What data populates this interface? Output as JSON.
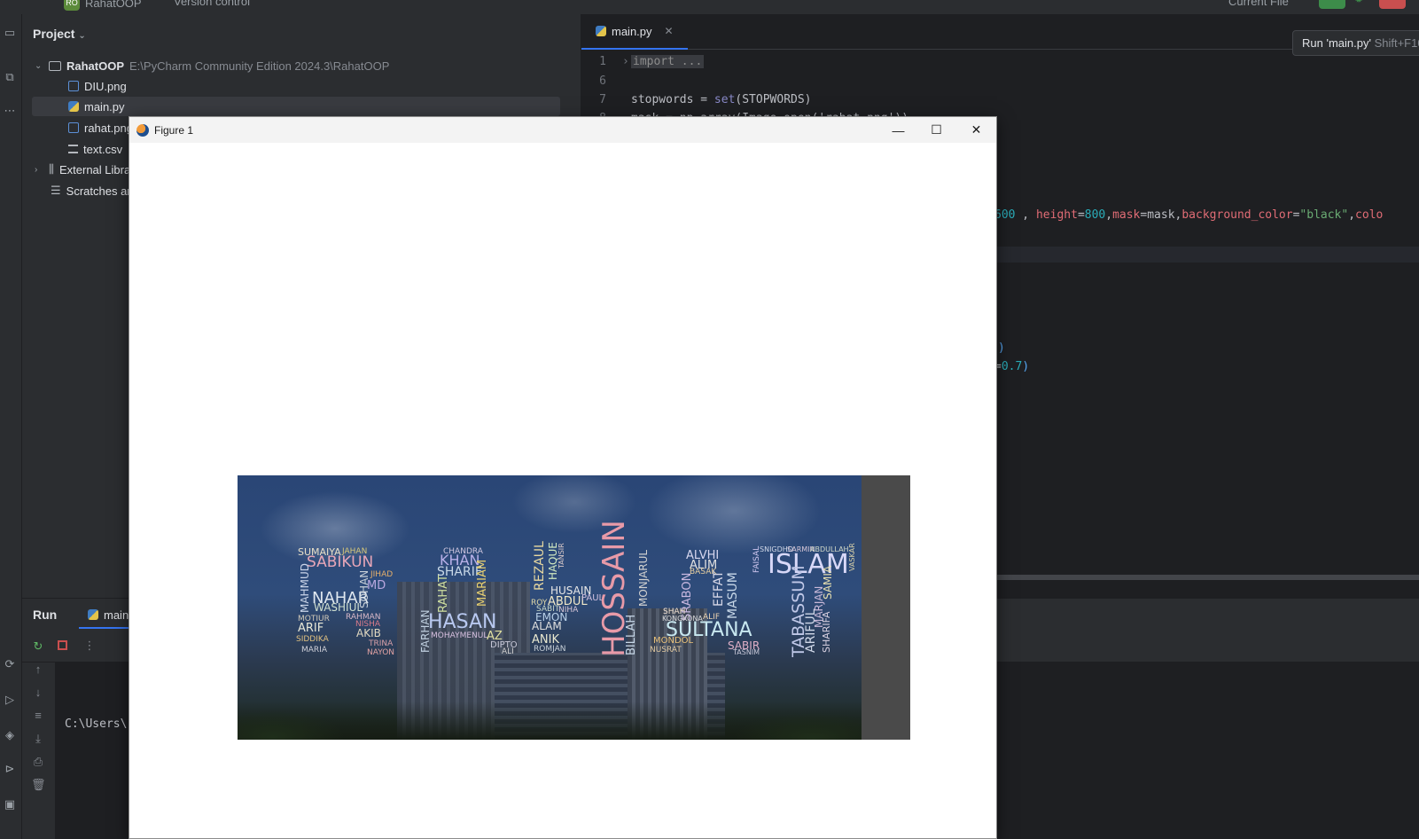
{
  "topbar": {
    "project_name": "RahatOOP",
    "project_badge": "RO",
    "version_control": "Version control",
    "run_config": "Current File"
  },
  "project_panel": {
    "title": "Project",
    "tree": [
      {
        "name": "RahatOOP",
        "path": "E:\\PyCharm Community Edition 2024.3\\RahatOOP",
        "type": "folder"
      },
      {
        "name": "DIU.png",
        "type": "image"
      },
      {
        "name": "main.py",
        "type": "python",
        "selected": true
      },
      {
        "name": "rahat.png",
        "type": "image"
      },
      {
        "name": "text.csv",
        "type": "text"
      },
      {
        "name": "External Libraries",
        "type": "library"
      },
      {
        "name": "Scratches and Consoles",
        "type": "scratches"
      }
    ]
  },
  "editor": {
    "tab": "main.py",
    "tooltip": {
      "title": "Run 'main.py'",
      "shortcut": "Shift+F10"
    },
    "lines": {
      "n1": "1",
      "l1": "import ...",
      "n6": "6",
      "n7": "7",
      "l7_var": "stopwords = ",
      "l7_fn": "set",
      "l7_arg": "(STOPWORDS)",
      "n8": "8",
      "l8": "mask = np.array(Image.open('rahat.png'))",
      "l_wc_w": "600",
      "l_wc_h_key": "height",
      "l_wc_h": "800",
      "l_wc_mask_key": "mask",
      "l_wc_mask": "mask",
      "l_wc_bg_key": "background_color",
      "l_wc_bg": "\"black\"",
      "l_wc_color_key": "colo",
      "l_paren": ")",
      "l_alpha": "0.7"
    }
  },
  "run_panel": {
    "title": "Run",
    "tab": "main",
    "console_text": "C:\\Users\\"
  },
  "figure": {
    "title": "Figure 1",
    "minimize": "—",
    "maximize": "☐",
    "close": "✕"
  },
  "wordcloud": {
    "words": [
      "SUMAIYA",
      "JAHAN",
      "SABIKUN",
      "MAHMUD",
      "NAHAR",
      "MD",
      "JIHAD",
      "WASHIUL",
      "SOHAN",
      "MOTIUR",
      "RAHMAN",
      "ARIF",
      "AKIB",
      "NISHA",
      "SIDDIKA",
      "TRINA",
      "MARIA",
      "NAYON",
      "CHANDRA",
      "KHAN",
      "SHARIF",
      "RAHAT",
      "MARIAM",
      "HASAN",
      "FARHAN",
      "MOHAYMENUL",
      "AZ",
      "DIPTO",
      "ALI",
      "REZAUL",
      "HAQUE",
      "TANSIR",
      "HUSAIN",
      "ABDUL",
      "PAUL",
      "ROY",
      "SABIT",
      "NIHA",
      "EMON",
      "ALAM",
      "ANIK",
      "ROMJAN",
      "HOSSAIN",
      "BILLAH",
      "MONJARUL",
      "ALVHI",
      "ALIM",
      "BASAK",
      "EFFAT",
      "MASUM",
      "SRABON",
      "SHAH",
      "KONGKONA",
      "ALIF",
      "SULTANA",
      "MONDOL",
      "NUSRAT",
      "SABIR",
      "TASNIM",
      "ISLAM",
      "SNIGDHO",
      "SARMIN",
      "ABDULLAH",
      "FAISAL",
      "TABASSUM",
      "ARIFUL",
      "MARJAN",
      "SHARIFA",
      "SAMIA",
      "VASKAR"
    ]
  }
}
